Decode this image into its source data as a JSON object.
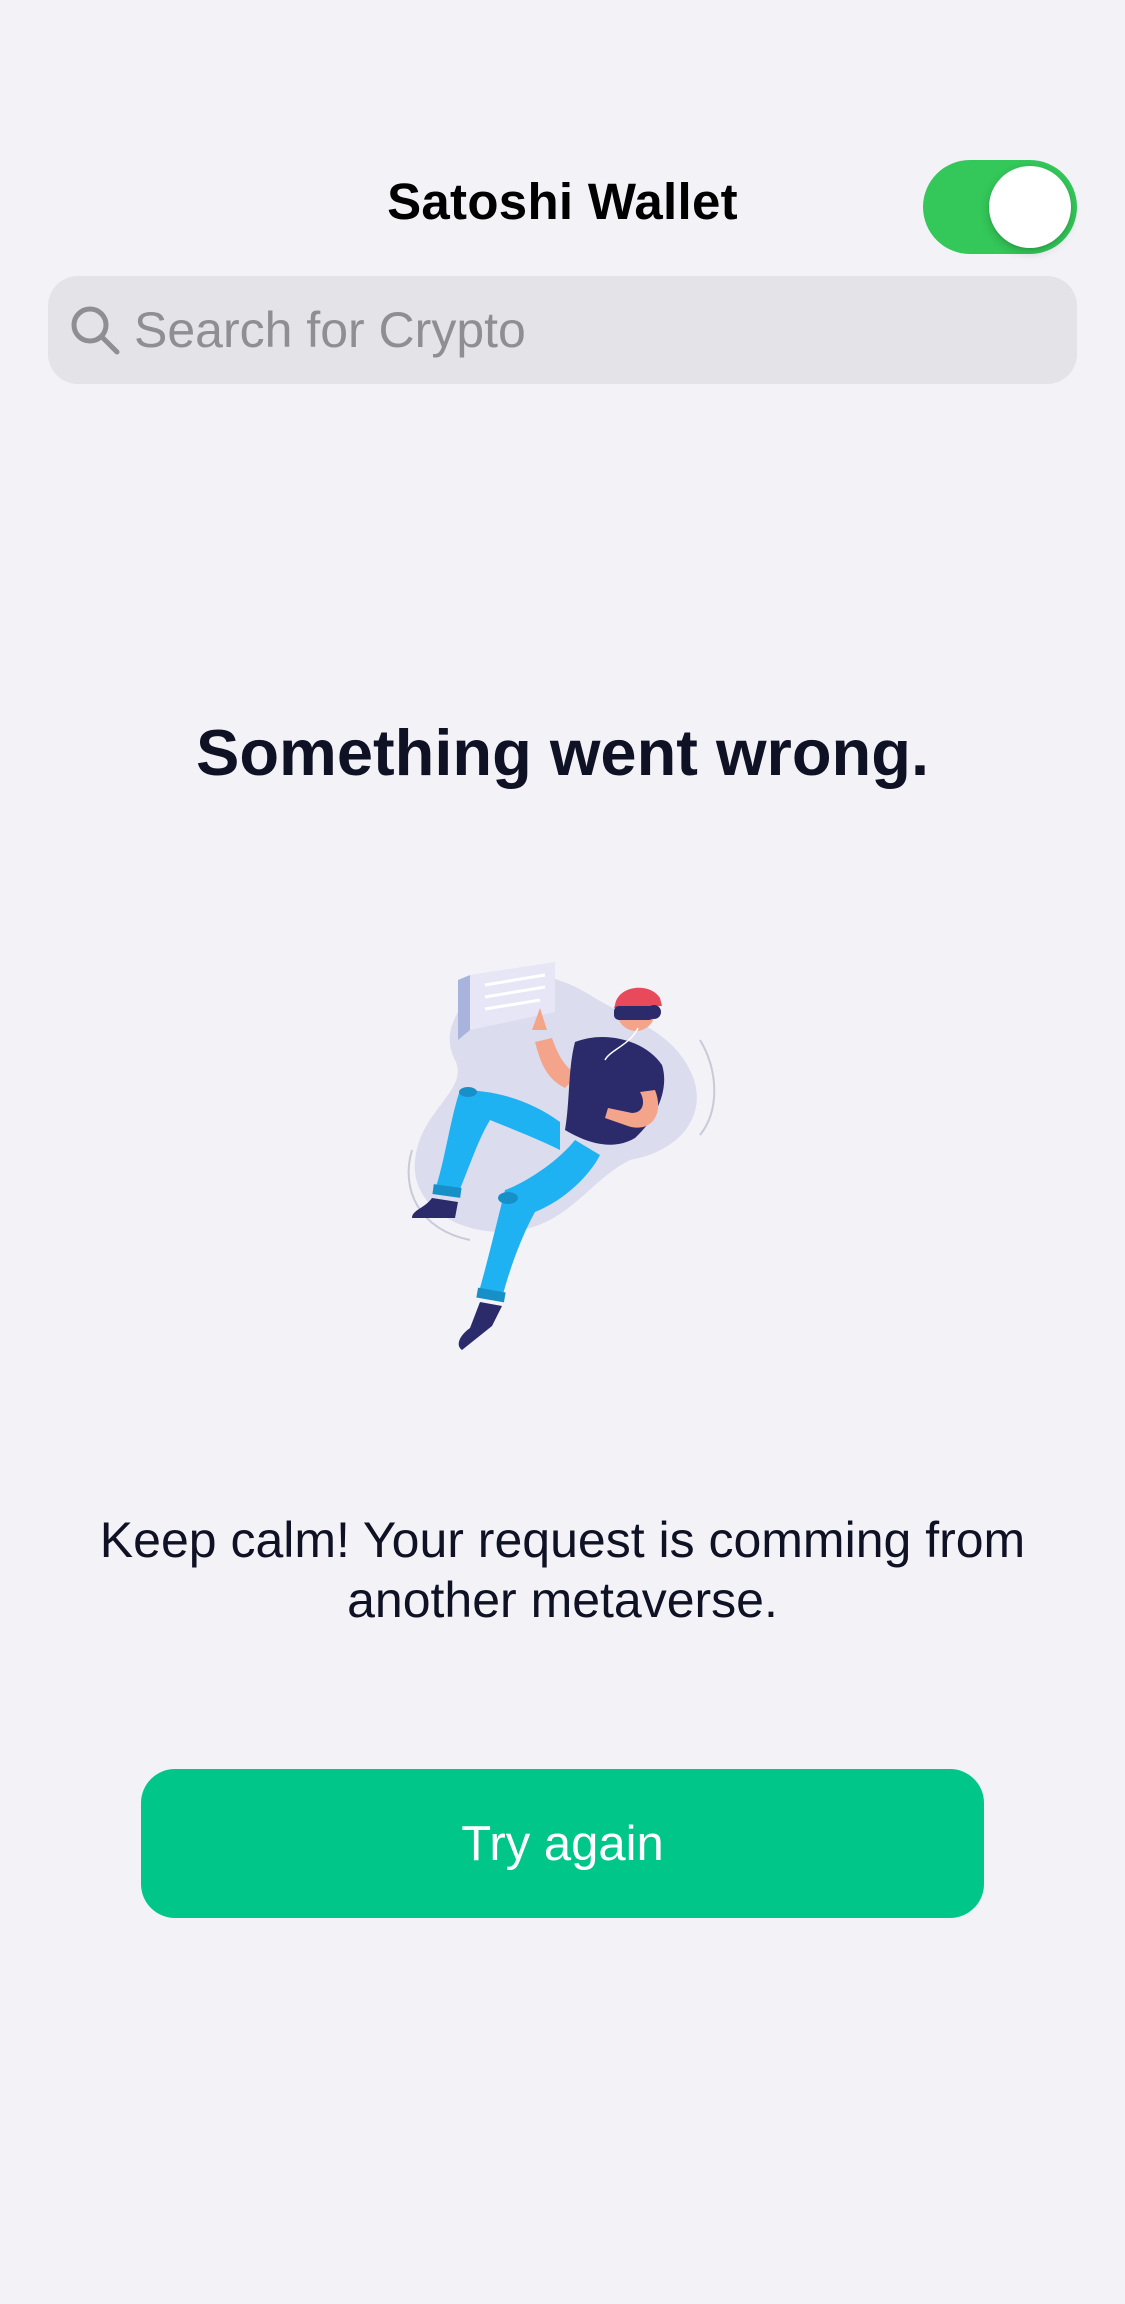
{
  "header": {
    "title": "Satoshi Wallet",
    "toggle": {
      "state": "on",
      "color": "#34c759"
    }
  },
  "search": {
    "placeholder": "Search for Crypto",
    "value": "",
    "icon": "search-icon"
  },
  "error": {
    "title": "Something went wrong.",
    "message": "Keep calm! Your request is comming from another metaverse.",
    "illustration": "person-in-vr-floating-illustration"
  },
  "action": {
    "label": "Try again",
    "color": "#00c689"
  }
}
